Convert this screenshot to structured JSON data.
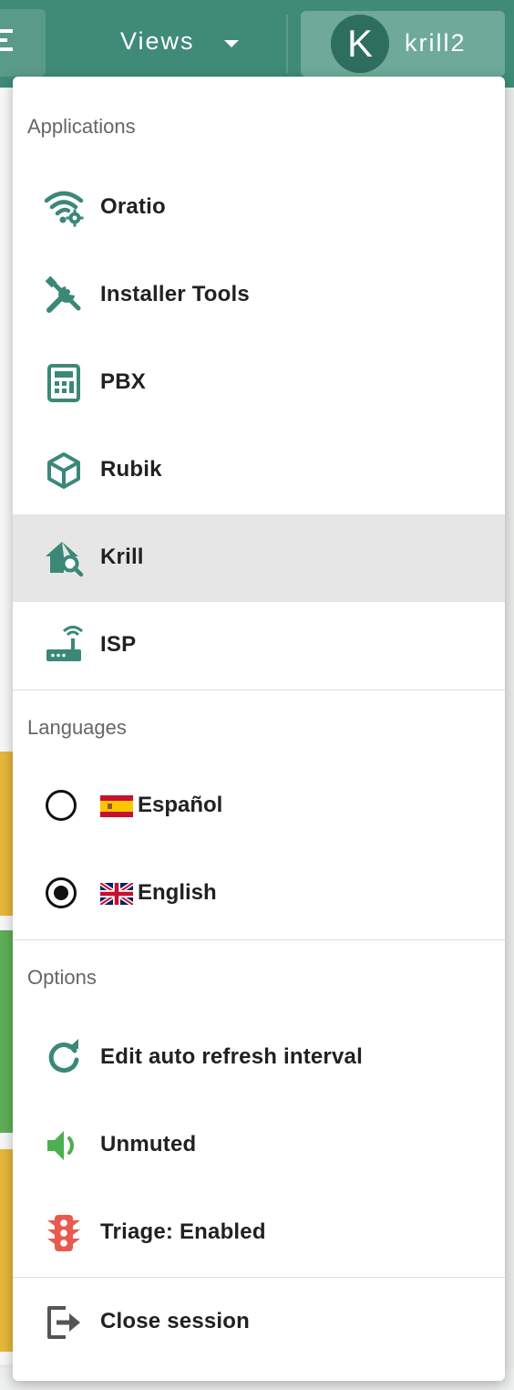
{
  "topbar": {
    "views_label": "Views",
    "user": {
      "initial": "K",
      "name": "krill2"
    }
  },
  "menu": {
    "applications_title": "Applications",
    "applications": [
      {
        "label": "Oratio",
        "icon": "wifi-gear-icon"
      },
      {
        "label": "Installer Tools",
        "icon": "tools-icon"
      },
      {
        "label": "PBX",
        "icon": "calculator-icon"
      },
      {
        "label": "Rubik",
        "icon": "cube-icon"
      },
      {
        "label": "Krill",
        "icon": "house-search-icon",
        "active": true
      },
      {
        "label": "ISP",
        "icon": "router-icon"
      }
    ],
    "languages_title": "Languages",
    "languages": [
      {
        "label": "Español",
        "flag": "spain-flag-icon",
        "selected": false
      },
      {
        "label": "English",
        "flag": "uk-flag-icon",
        "selected": true
      }
    ],
    "options_title": "Options",
    "options": [
      {
        "label": "Edit auto refresh interval",
        "icon": "refresh-icon"
      },
      {
        "label": "Unmuted",
        "icon": "volume-icon"
      },
      {
        "label": "Triage: Enabled",
        "icon": "traffic-light-icon"
      }
    ],
    "close_session": {
      "label": "Close session",
      "icon": "logout-icon"
    }
  },
  "colors": {
    "primary": "#3f8b78",
    "icon_teal": "#3b8878",
    "volume_green": "#4caf50",
    "traffic_red": "#e85a50"
  }
}
